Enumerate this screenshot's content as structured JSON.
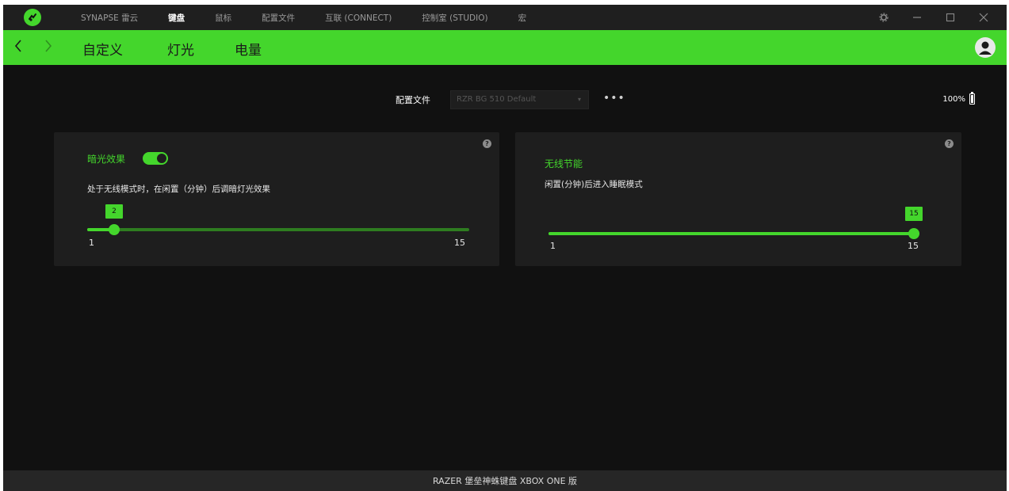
{
  "titlebar": {
    "nav": [
      "SYNAPSE 雷云",
      "键盘",
      "鼠标",
      "配置文件",
      "互联 (CONNECT)",
      "控制室 (STUDIO)",
      "宏"
    ],
    "active_index": 1
  },
  "subnav": {
    "tabs": [
      "自定义",
      "灯光",
      "电量"
    ],
    "active_tab": "电量"
  },
  "profile": {
    "label": "配置文件",
    "selected": "RZR BG 510 Default",
    "more": "•••"
  },
  "battery": {
    "percent": "100%",
    "level": 1.0
  },
  "card_dim": {
    "title": "暗光效果",
    "toggle_on": true,
    "description": "处于无线模式时，在闲置（分钟）后调暗灯光效果",
    "slider": {
      "min": 1,
      "max": 15,
      "value": 2,
      "min_label": "1",
      "max_label": "15",
      "value_label": "2"
    }
  },
  "card_power": {
    "title": "无线节能",
    "description": "闲置(分钟)后进入睡眠模式",
    "slider": {
      "min": 1,
      "max": 15,
      "value": 15,
      "min_label": "1",
      "max_label": "15",
      "value_label": "15"
    }
  },
  "footer": {
    "device_name": "RAZER 堡垒神蛛键盘 XBOX ONE 版"
  },
  "colors": {
    "accent": "#44d62c",
    "background": "#111111",
    "card": "#1e1e1e"
  }
}
